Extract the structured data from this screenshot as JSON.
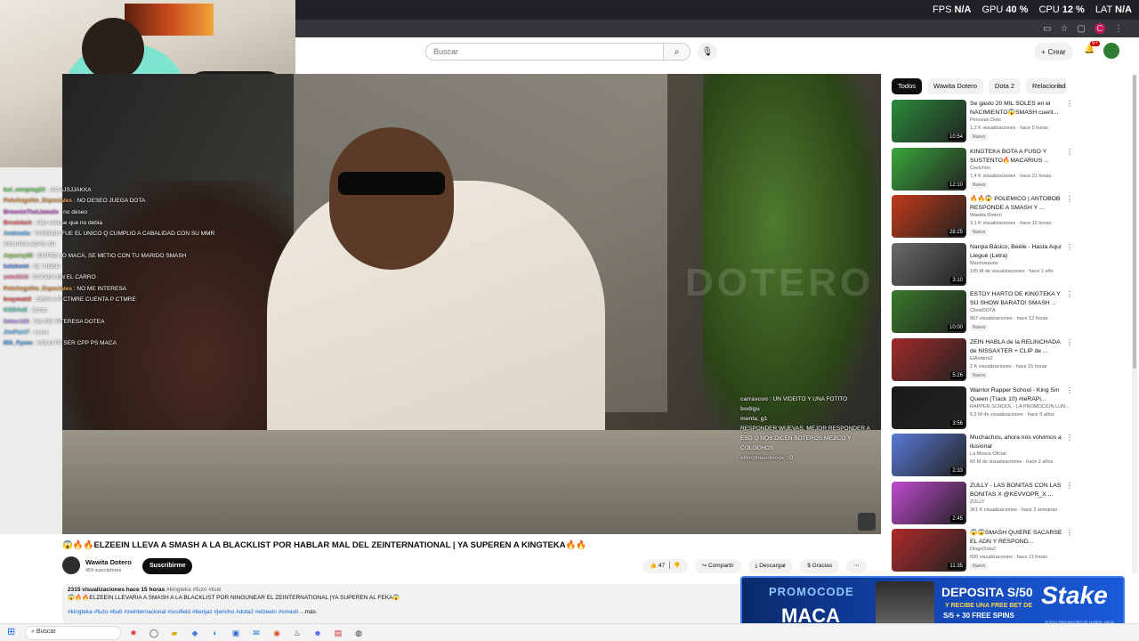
{
  "overlay_stats": {
    "fps_label": "FPS",
    "fps_value": "N/A",
    "gpu_label": "GPU",
    "gpu_value": "40 %",
    "cpu_label": "CPU",
    "cpu_value": "12 %",
    "lat_label": "LAT",
    "lat_value": "N/A"
  },
  "header": {
    "search_placeholder": "Buscar",
    "create_label": "Crear",
    "notifications_badge": "9+",
    "avatar_letter": "C"
  },
  "chat": [
    {
      "user": "bol_weeping23",
      "msg": "JAJAJSJJAKKA",
      "color": "#7fe07a"
    },
    {
      "user": "PeloAngelito_Especiales",
      "msg": "NO DESEO JUEGA DOTA",
      "color": "#f0a35a"
    },
    {
      "user": "BrownieTheLlamaIo",
      "msg": "no deseo",
      "color": "#d06fd8"
    },
    {
      "user": "Breakdark",
      "msg": "Oijo vaiarse que no debia",
      "color": "#ff7a7a"
    },
    {
      "user": "Andrealla",
      "msg": "TAMBIEN FUE EL UNICO Q CUMPLIO A CABALIDAD CON SU MMR",
      "color": "#6fc1ff"
    },
    {
      "user": "",
      "msg": "SIN ANULADAS XD",
      "color": "#ffffff"
    },
    {
      "user": "Aqasrey66",
      "msg": "ENTRE LO MACA, SE METIO CON TU MARIDO SMASH",
      "color": "#9fd86f"
    },
    {
      "user": "katahomi",
      "msg": "EL VIDEO",
      "color": "#6fa0ff"
    },
    {
      "user": "zoto3315",
      "msg": "ESTABA EN EL CARRO",
      "color": "#ff8fb0"
    },
    {
      "user": "PeloAngelito_Especiales",
      "msg": "NO ME INTERESA",
      "color": "#f0a35a"
    },
    {
      "user": "braymatt2",
      "msg": "SERA A P CTMRE CUENTA P CTMRE",
      "color": "#ff6b6b"
    },
    {
      "user": "KODAvE",
      "msg": "Zzzzz",
      "color": "#6fe0c8"
    },
    {
      "user": "fisher133",
      "msg": "NO ME INTERESA DOTEA",
      "color": "#c8a0ff"
    },
    {
      "user": "JimPar17",
      "msg": "xxxxx",
      "color": "#7fd0ff"
    },
    {
      "user": "MG_Fyzen",
      "msg": "SOLO PA SER CPP PS MACA",
      "color": "#66b3ff"
    }
  ],
  "video": {
    "watermark": "DOTERO",
    "overlay_chat": [
      {
        "user": "carrascoo",
        "msg": "UN VIDEITO Y UNA FOTITO"
      },
      {
        "user": "bodigu",
        "msg": ""
      },
      {
        "user": "menta_g1",
        "msg": ""
      },
      {
        "user": "",
        "msg": "RESPONDER WUEVAS. MEJOR RESPONDER A ESO Q NOS DICEN BOTEROS MEJICO Y COLOCHOS"
      },
      {
        "user": "elbromasokiode",
        "msg": "0"
      }
    ],
    "title": "😱🔥🔥ELZEEIN LLEVA A SMASH A LA BLACKLIST POR HABLAR MAL DEL ZEINTERNATIONAL | YA SUPEREN A KINGTEKA🔥🔥",
    "channel": "Wawita Dotero",
    "subscribers": "459 suscriptores",
    "subscribe_label": "Suscribirme",
    "likes": "47",
    "share_label": "Compartir",
    "download_label": "Descargar",
    "thanks_label": "Gracias",
    "views": "2315 visualizaciones",
    "time_ago": "hace 15 horas",
    "hashtags_top": "#kingteka #fuzo #buti",
    "description": "😱🔥🔥ELZEEIN LLEVARIA A SMASH A LA BLACKLIST POR NINGUNEAR EL ZEINTERNATIONAL |YA SUPEREN AL FEKA😱",
    "hashtags_bottom": "#kingteka #fuzo #buti #zeinternacional #scofield #benjaz #jericho #dota2 #elzeein #smash",
    "more_label": "...más"
  },
  "sidebar": {
    "chips": [
      "Todos",
      "Wawita Dotero",
      "Dota 2",
      "Relacionado"
    ],
    "items": [
      {
        "title": "Se gasto 20 MIL SOLES en el NACIMIENTO😱SMASH cuent...",
        "channel": "Peruvian Doto",
        "meta": "1,2 K visualizaciones · hace 5 horas",
        "new": "Nuevo",
        "duration": "10:54",
        "thumb": "#2a8c3a"
      },
      {
        "title": "KINGTEKA BOTA A FUSO Y SUSTENTO🔥MACARIUS ...",
        "channel": "Cevichon",
        "meta": "7,4 K visualizaciones · hace 21 horas",
        "new": "Nuevo",
        "duration": "12:10",
        "thumb": "#3aa83a"
      },
      {
        "title": "🔥🔥😱 POLEMICO | ANTOBOB RESPONDE A SMASH Y ...",
        "channel": "Wawita Dotero",
        "meta": "3,1 K visualizaciones · hace 12 horas",
        "new": "Nuevo",
        "duration": "28:25",
        "thumb": "#c23a1a"
      },
      {
        "title": "Nanpa Básico, Beéle - Hasta Aquí Llegué (Letra)",
        "channel": "Marinosaurio",
        "meta": "105 M de visualizaciones · hace 1 año",
        "new": "",
        "duration": "3:10",
        "thumb": "#6a6a6a"
      },
      {
        "title": "ESTOY HARTO DE KINGTEKA Y SU SHOW BARATO! SMASH ...",
        "channel": "CiloleDOTA",
        "meta": "907 visualizaciones · hace 12 horas",
        "new": "Nuevo",
        "duration": "10:00",
        "thumb": "#3a7a2a"
      },
      {
        "title": "ZEIN HABLA de la RELINCHADA de NISSAXTER + CLIP de ...",
        "channel": "ElAndersZ",
        "meta": "2 K visualizaciones · hace 15 horas",
        "new": "Nuevo",
        "duration": "5:26",
        "thumb": "#a32a2a"
      },
      {
        "title": "Warrior Rapper School - King Sin Queen (Track 10) #teRAPi...",
        "channel": "RAPPER SCHOOL - LA PROMOCION LUN...",
        "meta": "5,2 M de visualizaciones · hace 9 años",
        "new": "",
        "duration": "3:56",
        "thumb": "#1a1a1a"
      },
      {
        "title": "Muchachos, ahora nos volvimos a ilusionar",
        "channel": "La Mosca Oficial",
        "meta": "60 M de visualizaciones · hace 2 años",
        "new": "",
        "duration": "2:33",
        "thumb": "#5a7ad8"
      },
      {
        "title": "ZULLY - LAS BONITAS CON LAS BONITAS X @KEVVOPR_X ...",
        "channel": "ZULLY",
        "meta": "361 K visualizaciones · hace 2 semanas",
        "new": "",
        "duration": "2:45",
        "thumb": "#c04ad0"
      },
      {
        "title": "😱😱SMASH QUIERE SACARSE EL ADN Y RESPOND...",
        "channel": "DiogoDota2",
        "meta": "830 visualizaciones · hace 11 horas",
        "new": "Nuevo",
        "duration": "11:35",
        "thumb": "#b02a2a"
      }
    ]
  },
  "ad": {
    "promocode": "PROMOCODE",
    "code": "MACA",
    "deposit": "DEPOSITA S/50",
    "bonus_line1": "Y RECIBE UNA FREE BET DE",
    "bonus_line2": "S/5 + 30 FREE SPINS",
    "brand": "Stake",
    "fine_print": "18 SÓLO PARA MAYORES DE 18 AÑOS. JUEGA CON RESPONSABILIDAD."
  },
  "taskbar": {
    "search_label": "Buscar"
  },
  "colors": {
    "accent_red": "#cc0000",
    "link_blue": "#065fd4",
    "ad_blue": "#1346b4"
  }
}
